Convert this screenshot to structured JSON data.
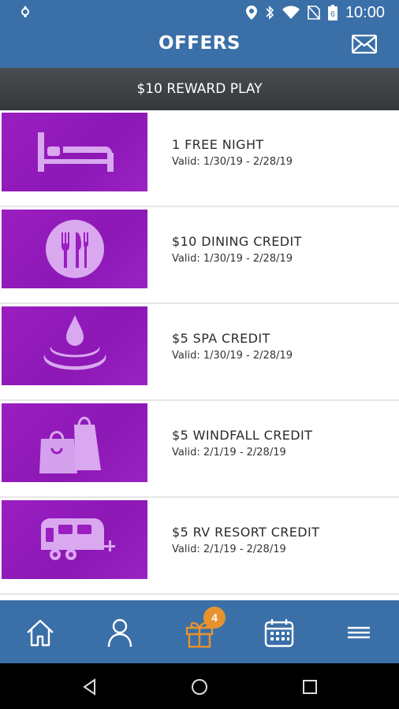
{
  "status_bar": {
    "time": "10:00",
    "battery_level": "6"
  },
  "app_bar": {
    "title": "OFFERS"
  },
  "reward_banner": {
    "label": "$10 REWARD PLAY"
  },
  "offers": [
    {
      "name": "1 FREE NIGHT",
      "valid": "Valid: 1/30/19 - 2/28/19",
      "icon": "bed-icon"
    },
    {
      "name": "$10 DINING CREDIT",
      "valid": "Valid: 1/30/19 - 2/28/19",
      "icon": "dining-icon"
    },
    {
      "name": "$5 SPA CREDIT",
      "valid": "Valid: 1/30/19 - 2/28/19",
      "icon": "spa-drop-icon"
    },
    {
      "name": "$5 WINDFALL CREDIT",
      "valid": "Valid: 2/1/19 - 2/28/19",
      "icon": "shopping-bags-icon"
    },
    {
      "name": "$5 RV RESORT CREDIT",
      "valid": "Valid: 2/1/19 - 2/28/19",
      "icon": "rv-trailer-icon"
    }
  ],
  "tab_bar": {
    "items": [
      {
        "icon": "home-icon"
      },
      {
        "icon": "profile-icon"
      },
      {
        "icon": "gift-icon",
        "active": true
      },
      {
        "icon": "calendar-icon"
      },
      {
        "icon": "menu-icon"
      }
    ],
    "gift_badge": "4"
  },
  "colors": {
    "primary": "#3a6fa8",
    "offer_purple": "#9b1ec0",
    "accent": "#e8922e",
    "icon_tint": "#d9a8ef"
  }
}
